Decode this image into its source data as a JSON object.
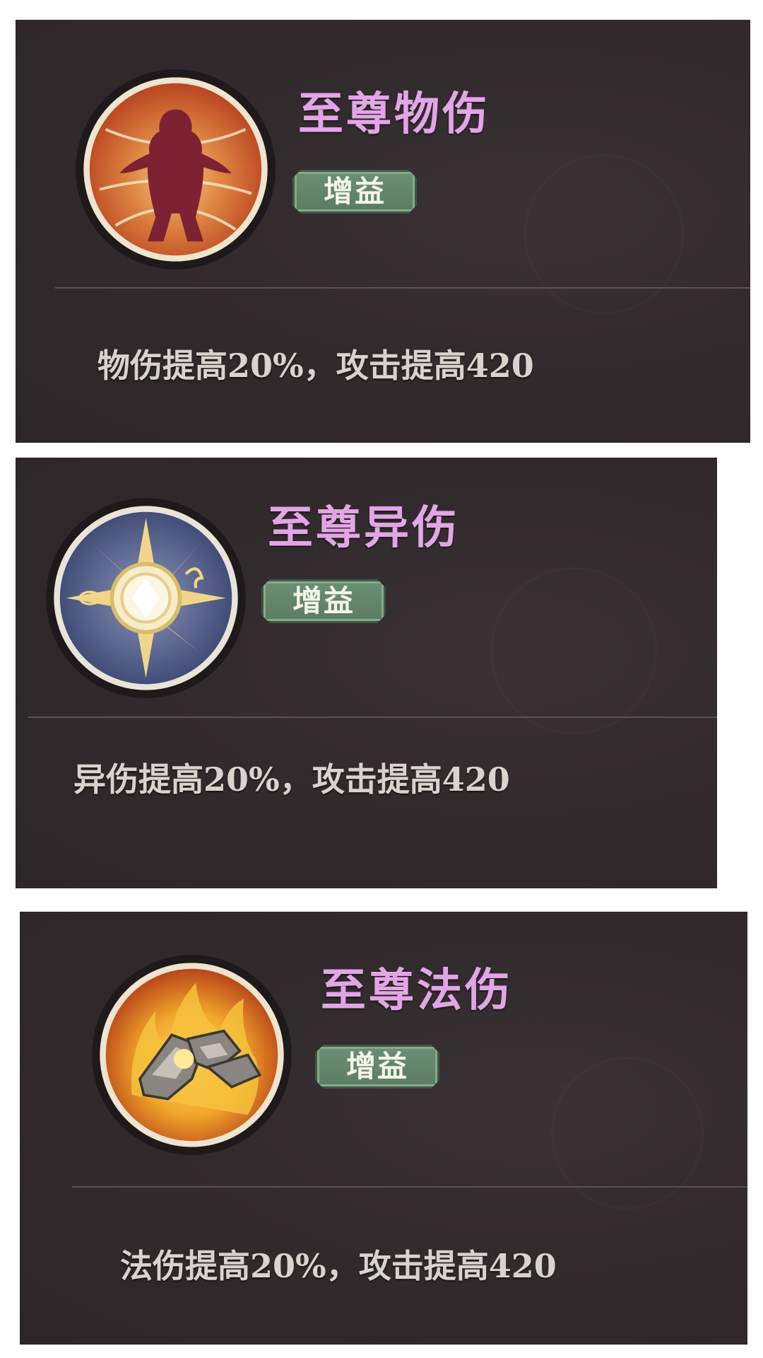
{
  "cards": [
    {
      "title": "至尊物伤",
      "tag": "增益",
      "description": "物伤提高20%，攻击提高420",
      "icon": "physical-damage-silhouette-icon"
    },
    {
      "title": "至尊异伤",
      "tag": "增益",
      "description": "异伤提高20%，攻击提高420",
      "icon": "anomaly-damage-sun-icon"
    },
    {
      "title": "至尊法伤",
      "tag": "增益",
      "description": "法伤提高20%，攻击提高420",
      "icon": "magic-damage-flame-icon"
    }
  ],
  "colors": {
    "card_bg": "#322b2d",
    "title": "#e2a6e6",
    "badge_bg": "#6c8f73",
    "badge_text": "#f2f6e6",
    "description": "#d9d3cf",
    "divider": "#5a5254"
  }
}
